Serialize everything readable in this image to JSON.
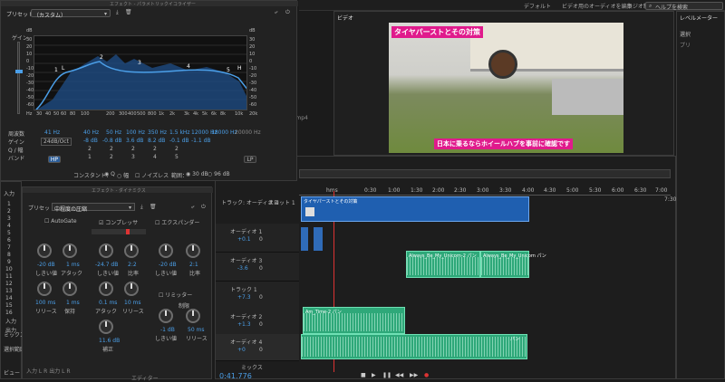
{
  "topbar": {
    "tabs": [
      "デフォルト",
      "ビデオ用のオーディオを編集",
      "ラジオ制作"
    ],
    "search_placeholder": "ヘルプを検索"
  },
  "eq": {
    "window_title": "エフェクト - パラメトリックイコライザー",
    "preset_label": "プリセット:",
    "preset_value": "（カスタム）",
    "gain_label": "ゲイン",
    "db_ticks_left": [
      "dB",
      "30",
      "20",
      "10",
      "0",
      "-10",
      "-20",
      "-30",
      "-40",
      "-50",
      "-60"
    ],
    "db_ticks_right": [
      "dB",
      "30",
      "20",
      "10",
      "0",
      "-10",
      "-20",
      "-30",
      "-40",
      "-50",
      "-60"
    ],
    "freq_ticks": [
      "Hz",
      "30",
      "40",
      "50",
      "60",
      "80",
      "100",
      "200",
      "300",
      "400",
      "500",
      "800",
      "1k",
      "2k",
      "3k",
      "4k",
      "5k",
      "6k",
      "8k",
      "10k",
      "20k",
      "Hz"
    ],
    "row_labels": [
      "周波数",
      "ゲイン",
      "Q / 幅",
      "バンド"
    ],
    "slope_label": "24dB/Oct",
    "freqs": [
      "41 Hz",
      "40 Hz",
      "50 Hz",
      "100 Hz",
      "350 Hz",
      "1.5 kHz",
      "12000 Hz",
      "18000 Hz",
      "20000 Hz"
    ],
    "gains": [
      "-8 dB",
      "-0.8 dB",
      "3.6 dB",
      "8.2 dB",
      "-0.1 dB",
      "-1.1 dB"
    ],
    "qs": [
      "2",
      "2",
      "2",
      "2",
      "2"
    ],
    "bands": [
      "1",
      "2",
      "3",
      "4",
      "5"
    ],
    "hp": "HP",
    "lp": "LP",
    "constant_label": "コンスタント：",
    "q_option": "Q",
    "width_option": "幅",
    "noiseless": "ノイズレス",
    "range_label": "範囲：",
    "range_30": "30 dB",
    "range_96": "96 dB",
    "curve_points": [
      "1",
      "2",
      "3",
      "4",
      "5",
      "L",
      "H",
      "HP",
      "LP"
    ]
  },
  "dyn": {
    "window_title": "エフェクト - ダイナミクス",
    "preset_label": "プリセット:",
    "preset_value": "中程度の圧縮",
    "sections": [
      "AutoGate",
      "コンプレッサ",
      "エクスパンダー",
      "リミッター"
    ],
    "autogate": {
      "threshold_val": "-20 dB",
      "threshold": "しきい値",
      "attack_val": "1 ms",
      "attack": "アタック",
      "release_val": "100 ms",
      "release": "リリース",
      "hold_val": "1 ms",
      "hold": "保持"
    },
    "comp": {
      "threshold_val": "-24.7 dB",
      "threshold": "しきい値",
      "ratio_val": "2:2",
      "ratio": "比率",
      "attack_val": "0.1 ms",
      "attack": "アタック",
      "release_val": "10 ms",
      "release": "リリース",
      "makeup_val": "11.6 dB",
      "makeup": "補正"
    },
    "exp": {
      "threshold_val": "-20 dB",
      "threshold": "しきい値",
      "ratio_val": "2:1",
      "ratio": "比率"
    },
    "lim": {
      "threshold_val": "-1 dB",
      "threshold": "しきい値",
      "release_val": "50 ms",
      "release": "リリース",
      "attack": "制限"
    }
  },
  "video": {
    "panel_title": "ビデオ",
    "top_caption": "タイヤパーストとその対策",
    "bottom_caption": "日本に乗るならホイールハブを事前に確認です"
  },
  "left_strip": {
    "labels": [
      "入力",
      "ミックス",
      "選択範囲",
      "ビュー"
    ],
    "numbers": [
      "1",
      "2",
      "3",
      "4",
      "5",
      "6",
      "7",
      "8",
      "9",
      "10",
      "11",
      "12",
      "13",
      "14",
      "15",
      "16"
    ],
    "bottom_text": "入力 L R  出力 L R",
    "input_label": "入力",
    "output_label": "出力",
    "editor": "エディター"
  },
  "right": {
    "panel_title": "レベルメーター",
    "labels": [
      "選択",
      "プリ"
    ]
  },
  "timeline": {
    "header_track": "トラック: オーディオ 4",
    "slot_label": "スロット 1",
    "filename": "g01.mp4",
    "ruler": [
      "hms",
      "0:30",
      "1:00",
      "1:30",
      "2:00",
      "2:30",
      "3:00",
      "3:30",
      "4:00",
      "4:30",
      "5:00",
      "5:30",
      "6:00",
      "6:30",
      "7:00",
      "7:30"
    ],
    "video_clip": "タイヤパーストとその対策",
    "time": "0:41.776",
    "mix_label": "ミックス",
    "tracks": [
      {
        "name": "オーディオ 1",
        "vol": "+0.1",
        "pan": "0"
      },
      {
        "name": "オーディオ 3",
        "vol": "-3.6",
        "pan": "0"
      },
      {
        "name": "トラック 1",
        "vol": "+7.3",
        "pan": "0"
      },
      {
        "name": "オーディオ 2",
        "vol": "+1.3",
        "pan": "0"
      },
      {
        "name": "オーディオ 4",
        "vol": "+0",
        "pan": "0"
      }
    ],
    "clips": [
      "Always_Be_My_Unicorn-2 パン",
      "Always_Be_My_Unicorn パン",
      "Am_Time-2 パン",
      "パン"
    ]
  }
}
